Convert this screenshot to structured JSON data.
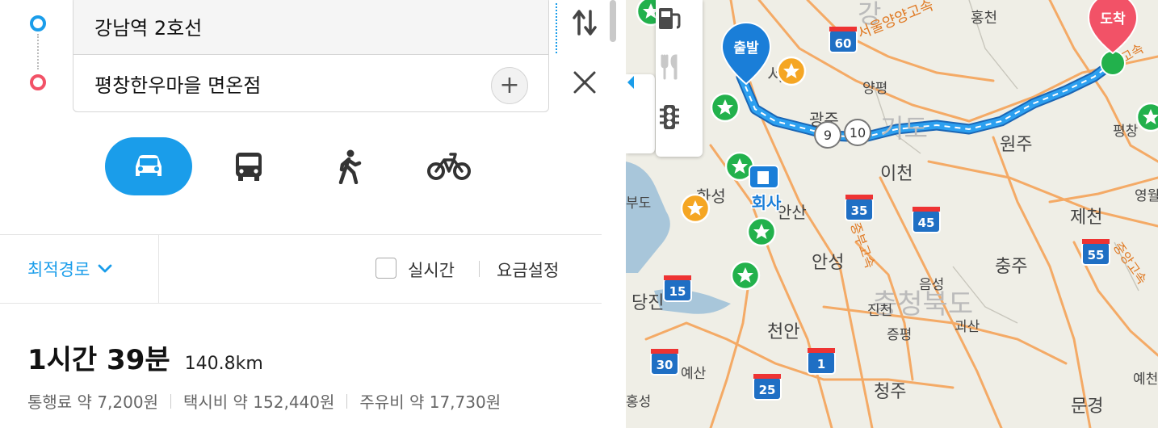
{
  "route": {
    "origin": "강남역 2호선",
    "destination": "평창한우마을 면온점",
    "add_label": "+"
  },
  "modes": [
    {
      "name": "car",
      "icon": "car-icon",
      "selected": true
    },
    {
      "name": "bus",
      "icon": "bus-icon",
      "selected": false
    },
    {
      "name": "walk",
      "icon": "walk-icon",
      "selected": false
    },
    {
      "name": "bike",
      "icon": "bike-icon",
      "selected": false
    }
  ],
  "options": {
    "route_type": "최적경로",
    "realtime_label": "실시간",
    "realtime_checked": false,
    "fee_label": "요금설정"
  },
  "summary": {
    "time": "1시간 39분",
    "distance": "140.8km",
    "toll": "통행료 약 7,200원",
    "taxi": "택시비 약 152,440원",
    "fuel": "주유비 약 17,730원"
  },
  "map": {
    "markers": {
      "start": "출발",
      "end": "도착",
      "company": "회사"
    },
    "route_labels": [
      "9",
      "10"
    ],
    "highway_shields": [
      "60",
      "35",
      "45",
      "55",
      "15",
      "30",
      "1",
      "25"
    ],
    "places": [
      "서울양양고속",
      "홍천",
      "양평",
      "광주",
      "원주",
      "이천",
      "화성",
      "평창",
      "영월",
      "제천",
      "부도",
      "안성",
      "충주",
      "음성",
      "당진",
      "진천",
      "충청북도",
      "중부고속",
      "중앙고속",
      "천안",
      "증평",
      "괴산",
      "예산",
      "청주",
      "홍성",
      "문경",
      "예천",
      "고속",
      "서울",
      "안산"
    ],
    "tools": [
      "gas-station-icon",
      "restaurant-icon",
      "traffic-light-icon"
    ],
    "colors": {
      "route": "#1a8fe0",
      "accent": "#1a9dea",
      "goal": "#f25267",
      "star_green": "#22b14c",
      "star_orange": "#f5a623",
      "road": "#f0a05a"
    }
  }
}
